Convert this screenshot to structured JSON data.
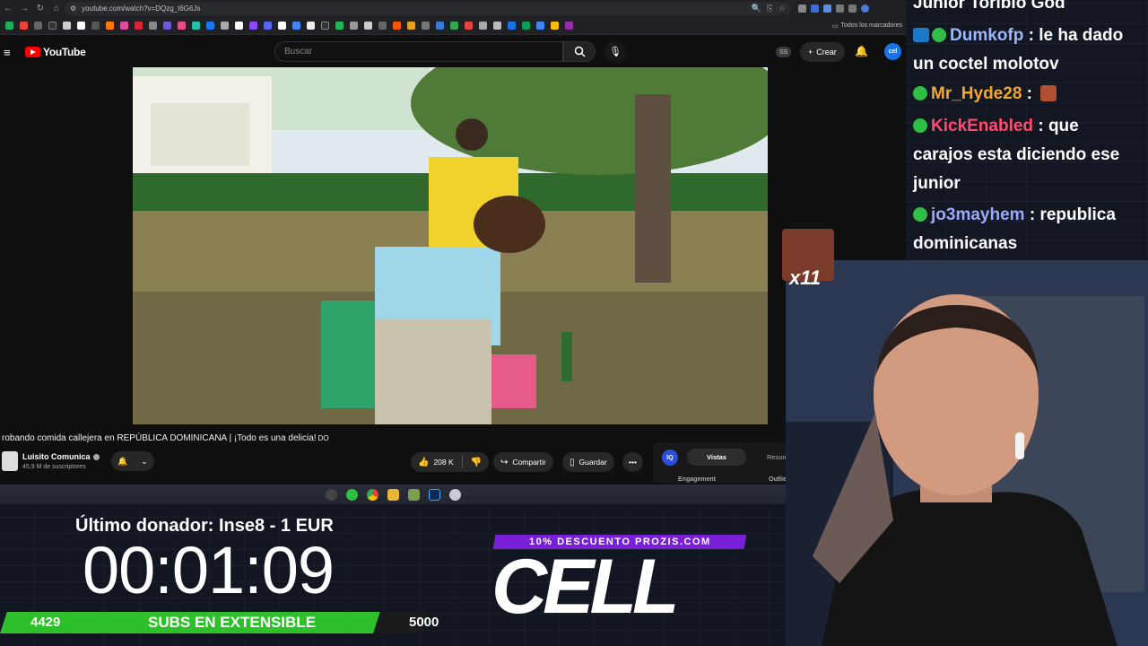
{
  "browser": {
    "url": "youtube.com/watch?v=DQzg_t6G6Js",
    "bookmarks_all_label": "Todos los marcadores"
  },
  "youtube": {
    "logo_text": "YouTube",
    "search_placeholder": "Buscar",
    "ss_badge": "SS",
    "create_label": "Crear",
    "avatar_text": "cel",
    "video_title": "robando comida callejera en REPÚBLICA DOMINICANA | ¡Todo es una delicia!",
    "video_title_suffix": "DO",
    "channel_name": "Luisito Comunica",
    "channel_subs": "45,9 M de suscriptores",
    "likes": "208 K",
    "share_label": "Compartir",
    "save_label": "Guardar",
    "more_label": "•••",
    "panel": {
      "iq": "IQ",
      "tab_active": "Vistas",
      "tab_other": "Resum",
      "label_left": "Engagement",
      "label_right": "Outlie"
    }
  },
  "overlay": {
    "donor_text": "Último donador: Inse8 - 1 EUR",
    "timer": "00:01:09",
    "subs_start": "4429",
    "subs_label": "SUBS EN EXTENSIBLE",
    "subs_goal": "5000",
    "subs_progress": 0.886,
    "promo_text": "10% DESCUENTO PROZIS.COM",
    "brand_text": "CELL"
  },
  "chat": {
    "messages": [
      {
        "user": "Junior Toribio God",
        "text": "",
        "user_color": "#ffffff"
      },
      {
        "user": "Dumkofp",
        "text": "le ha dado un coctel molotov",
        "user_color": "#9bb8ff"
      },
      {
        "user": "Mr_Hyde28",
        "text": "",
        "user_color": "#f0a830"
      },
      {
        "user": "KickEnabled",
        "text": "que carajos esta diciendo ese junior",
        "user_color": "#ff4b6e"
      },
      {
        "user": "jo3mayhem",
        "text": "republica dominicanas",
        "user_color": "#9aa8ff"
      }
    ],
    "emote_count": "x11"
  },
  "colors": {
    "accent_green": "#2ec02b",
    "promo_purple": "#7a1fd8",
    "youtube_red": "#ff0000"
  }
}
